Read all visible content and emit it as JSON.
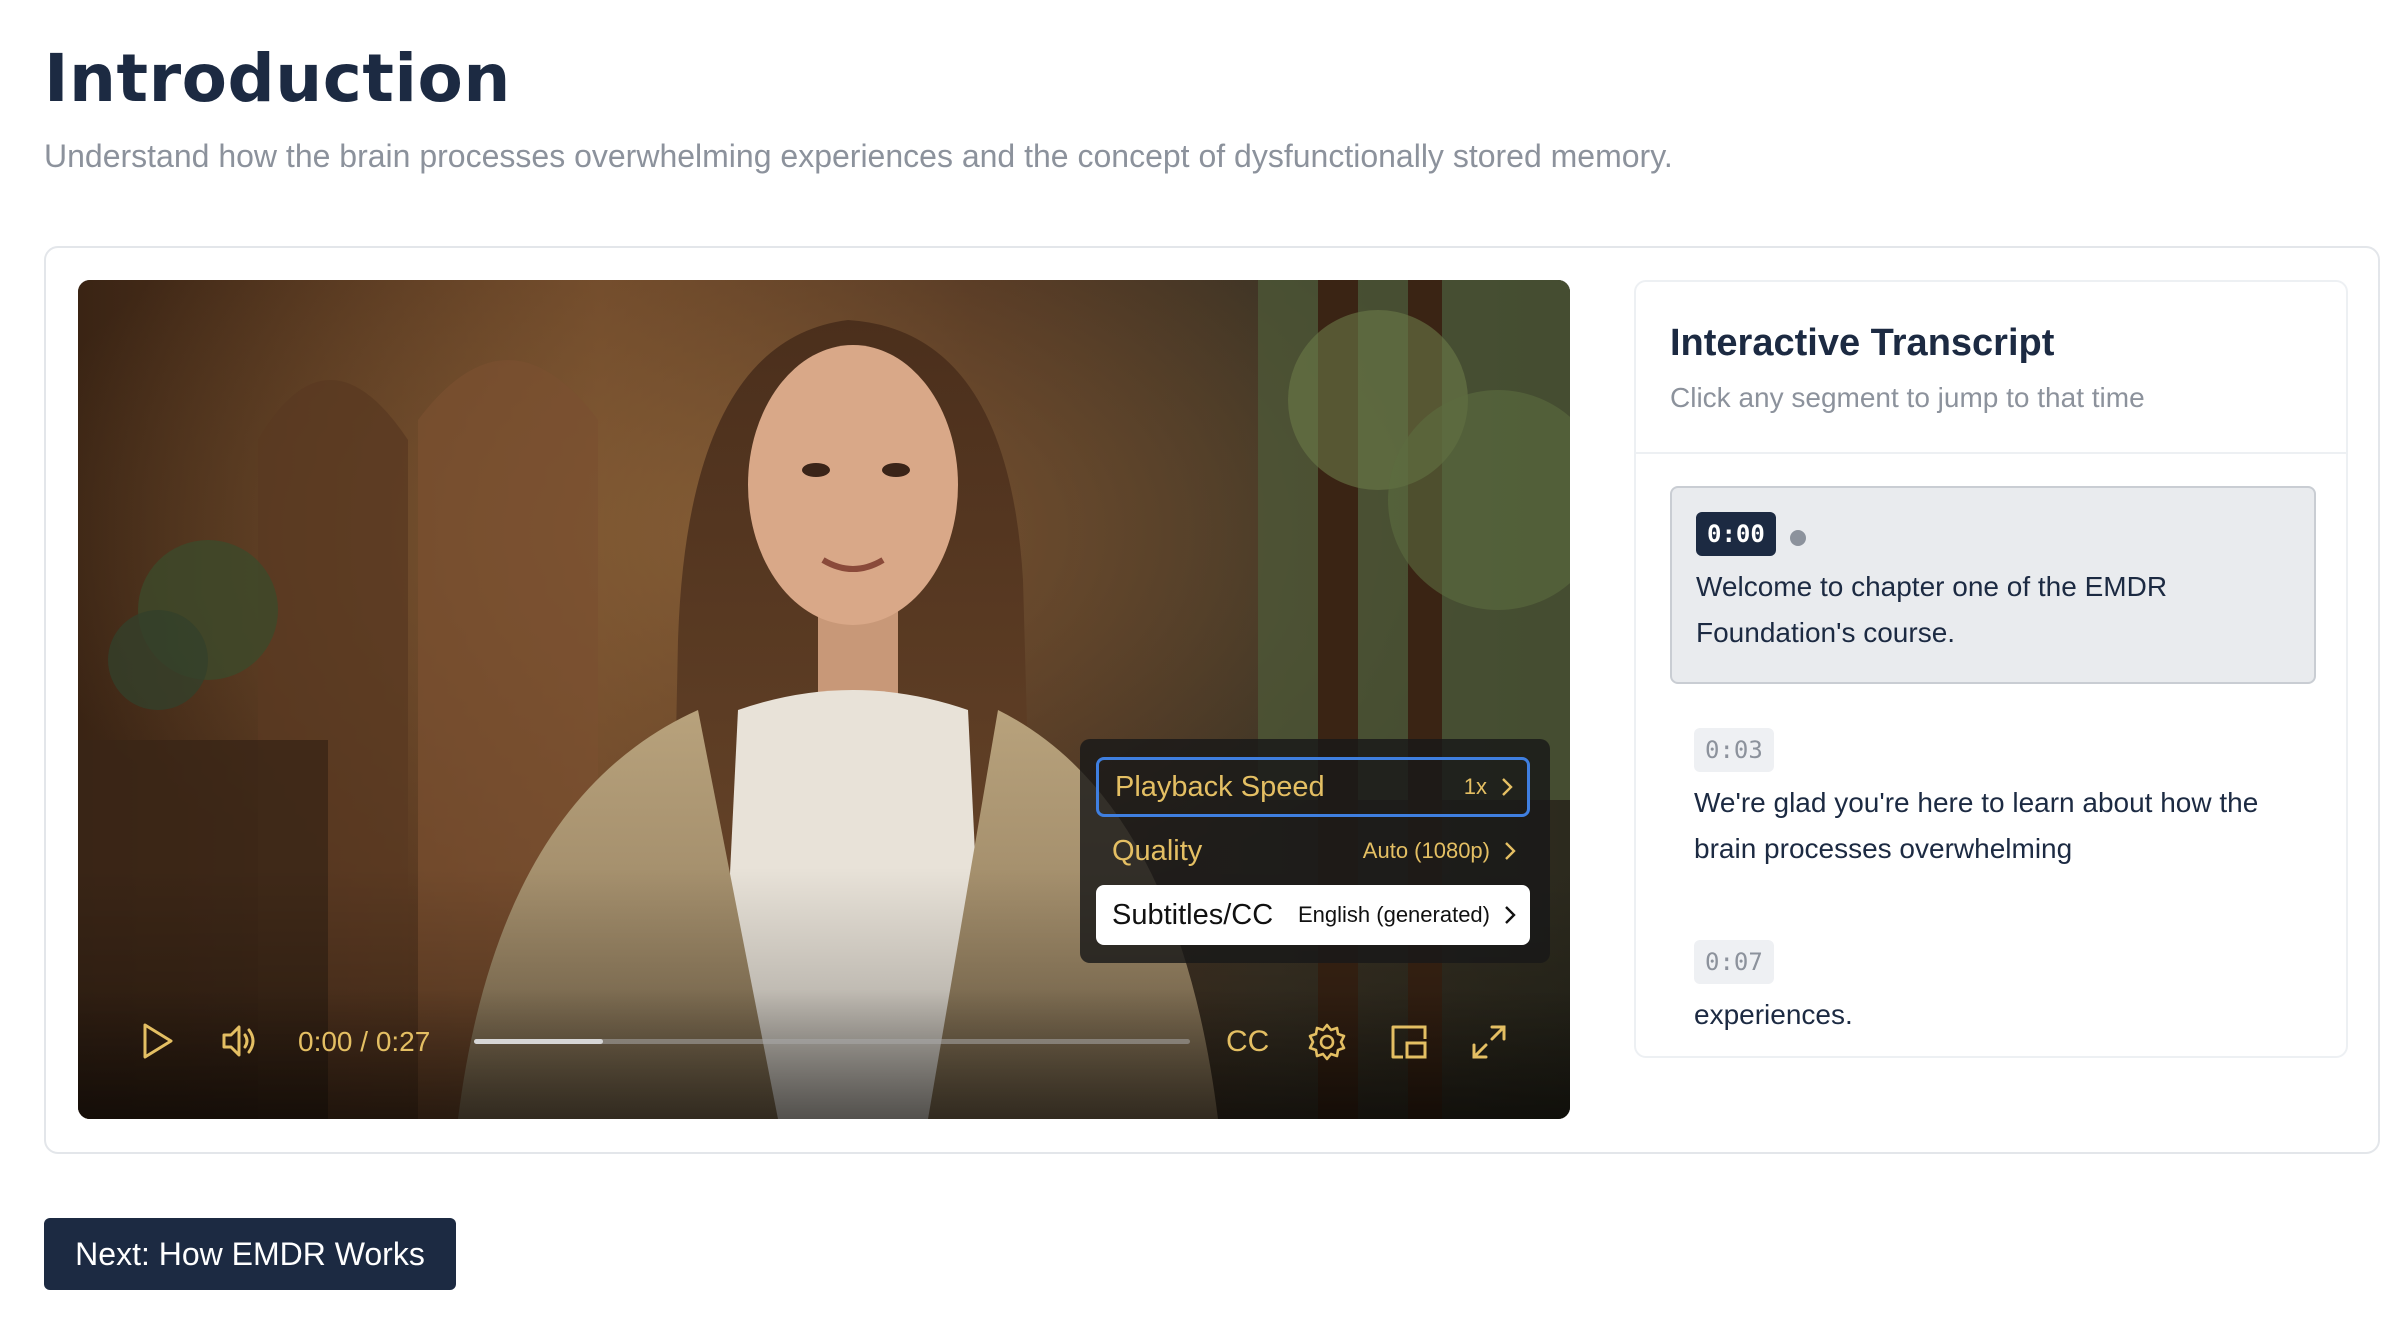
{
  "page": {
    "title": "Introduction",
    "subtitle": "Understand how the brain processes overwhelming experiences and the concept of dysfunctionally stored memory."
  },
  "video": {
    "time_display": "0:00 / 0:27",
    "current_time": "0:00",
    "duration": "0:27",
    "buffered_fraction": 0.18,
    "cc_label": "CC",
    "accent_color": "#e4bf63",
    "settings_menu": [
      {
        "label": "Playback Speed",
        "value": "1x",
        "state": "focused"
      },
      {
        "label": "Quality",
        "value": "Auto (1080p)",
        "state": "normal"
      },
      {
        "label": "Subtitles/CC",
        "value": "English (generated)",
        "state": "selected"
      }
    ],
    "icons": [
      "play-icon",
      "volume-icon",
      "settings-gear-icon",
      "picture-in-picture-icon",
      "fullscreen-icon",
      "chevron-right-icon"
    ]
  },
  "transcript": {
    "title": "Interactive Transcript",
    "hint": "Click any segment to jump to that time",
    "segments": [
      {
        "time": "0:00",
        "text": "Welcome to chapter one of the EMDR Foundation's course.",
        "active": true
      },
      {
        "time": "0:03",
        "text": "We're glad you're here to learn about how the brain processes overwhelming",
        "active": false
      },
      {
        "time": "0:07",
        "text": "experiences.",
        "active": false
      }
    ]
  },
  "navigation": {
    "next_label": "Next: How EMDR Works"
  },
  "colors": {
    "primary": "#1c2a42",
    "muted_text": "#8c929c",
    "focus_ring": "#3f7fe0"
  }
}
